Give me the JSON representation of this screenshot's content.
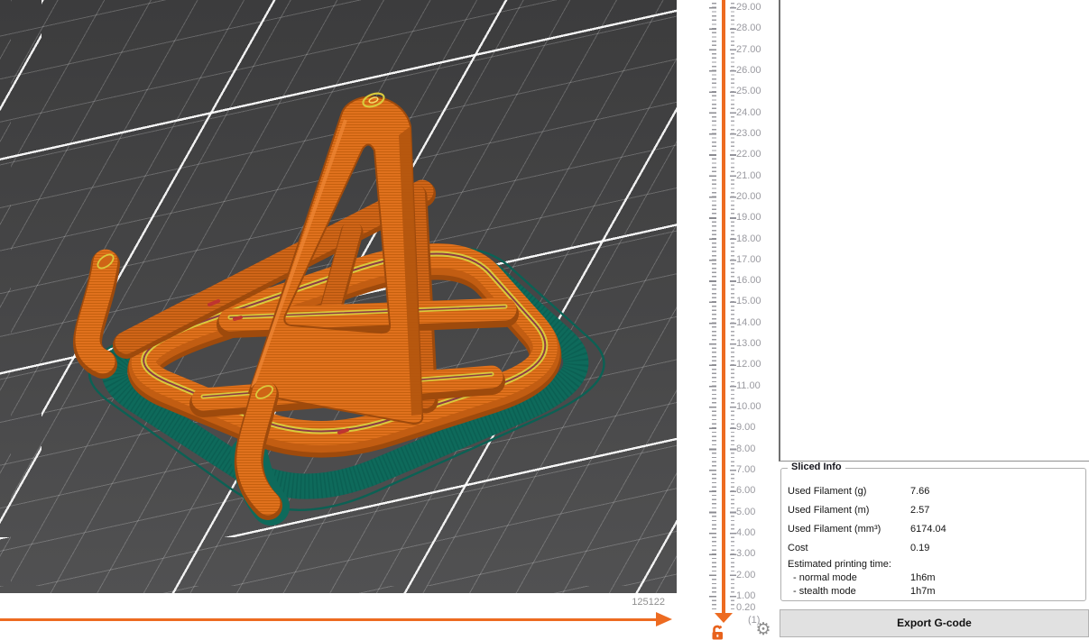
{
  "viewport": {
    "description": "sliced 3D model preview on print bed",
    "move_slider_value": "125122"
  },
  "layer_slider": {
    "tick_labels": [
      "29.00",
      "28.00",
      "27.00",
      "26.00",
      "25.00",
      "24.00",
      "23.00",
      "22.00",
      "21.00",
      "20.00",
      "19.00",
      "18.00",
      "17.00",
      "16.00",
      "15.00",
      "14.00",
      "13.00",
      "12.00",
      "11.00",
      "10.00",
      "9.00",
      "8.00",
      "7.00",
      "6.00",
      "5.00",
      "4.00",
      "3.00",
      "2.00",
      "1.00",
      "0.20",
      "(1)"
    ],
    "accent_color": "#ED6B21"
  },
  "icons": {
    "lock_icon": "unlocked-padlock",
    "gear_icon": "settings-gear",
    "gear_glyph": "⚙"
  },
  "sliced_info": {
    "title": "Sliced Info",
    "rows": [
      {
        "label": "Used Filament (g)",
        "value": "7.66"
      },
      {
        "label": "Used Filament (m)",
        "value": "2.57"
      },
      {
        "label": "Used Filament (mm³)",
        "value": "6174.04"
      },
      {
        "label": "Cost",
        "value": "0.19"
      }
    ],
    "time_header": "Estimated printing time:",
    "time_rows": [
      {
        "label": "- normal mode",
        "value": "1h6m"
      },
      {
        "label": "- stealth mode",
        "value": "1h7m"
      }
    ]
  },
  "export_button_label": "Export G-code",
  "colors": {
    "accent_orange": "#ED6B21",
    "model_orange": "#E0711D",
    "brim_teal": "#0E6A5B",
    "infill_yellow": "#D9CA3C",
    "viewport_bg": "#454546"
  }
}
